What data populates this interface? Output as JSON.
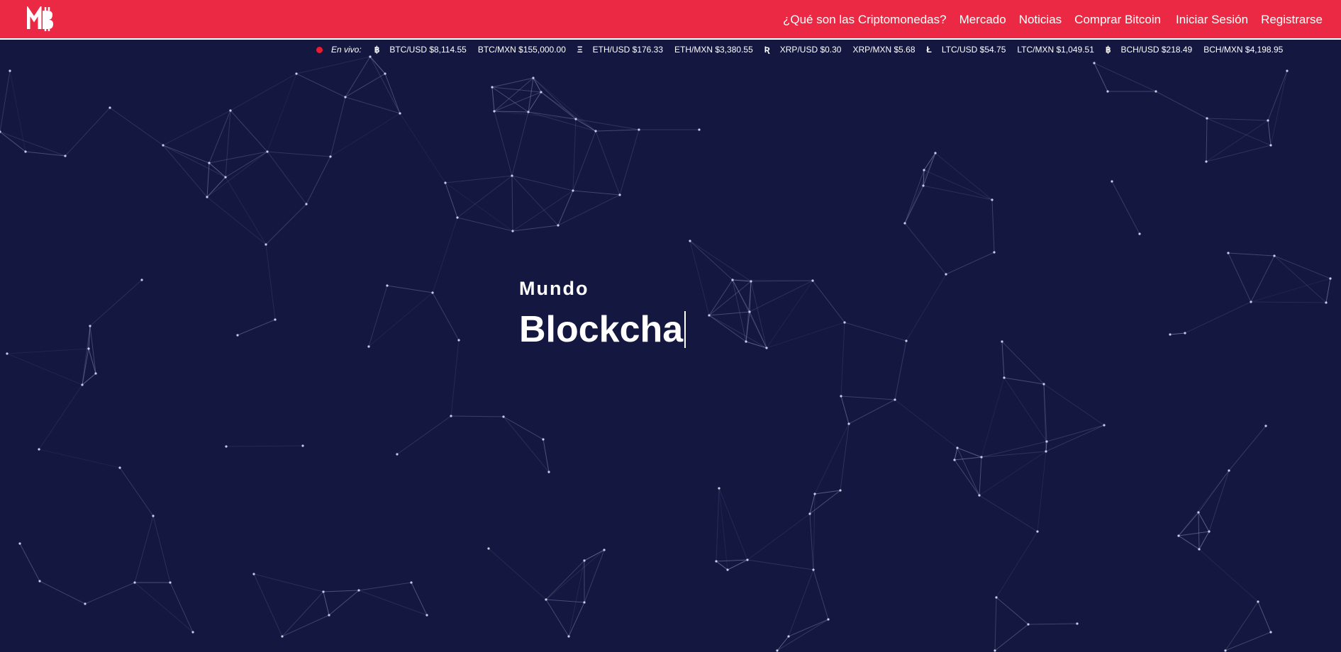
{
  "brand": {
    "logo_text": "MB"
  },
  "nav": {
    "left": [
      "¿Qué son las Criptomonedas?",
      "Mercado",
      "Noticias",
      "Comprar Bitcoin"
    ],
    "right": [
      "Iniciar Sesión",
      "Registrarse"
    ]
  },
  "ticker": {
    "live_label": "En vivo:",
    "groups": [
      {
        "icon": "฿",
        "prices": [
          "BTC/USD $8,114.55",
          "BTC/MXN $155,000.00"
        ]
      },
      {
        "icon": "Ξ",
        "prices": [
          "ETH/USD $176.33",
          "ETH/MXN $3,380.55"
        ]
      },
      {
        "icon": "Ʀ",
        "prices": [
          "XRP/USD $0.30",
          "XRP/MXN $5.68"
        ]
      },
      {
        "icon": "Ł",
        "prices": [
          "LTC/USD $54.75",
          "LTC/MXN $1,049.51"
        ]
      },
      {
        "icon": "฿",
        "prices": [
          "BCH/USD $218.49",
          "BCH/MXN $4,198.95"
        ]
      }
    ]
  },
  "hero": {
    "kicker": "Mundo",
    "title": "Blockcha"
  },
  "colors": {
    "navbar": "#ec2944",
    "background": "#141840",
    "live_dot": "#ec1c2e",
    "network_lines": "#8a90b8"
  }
}
